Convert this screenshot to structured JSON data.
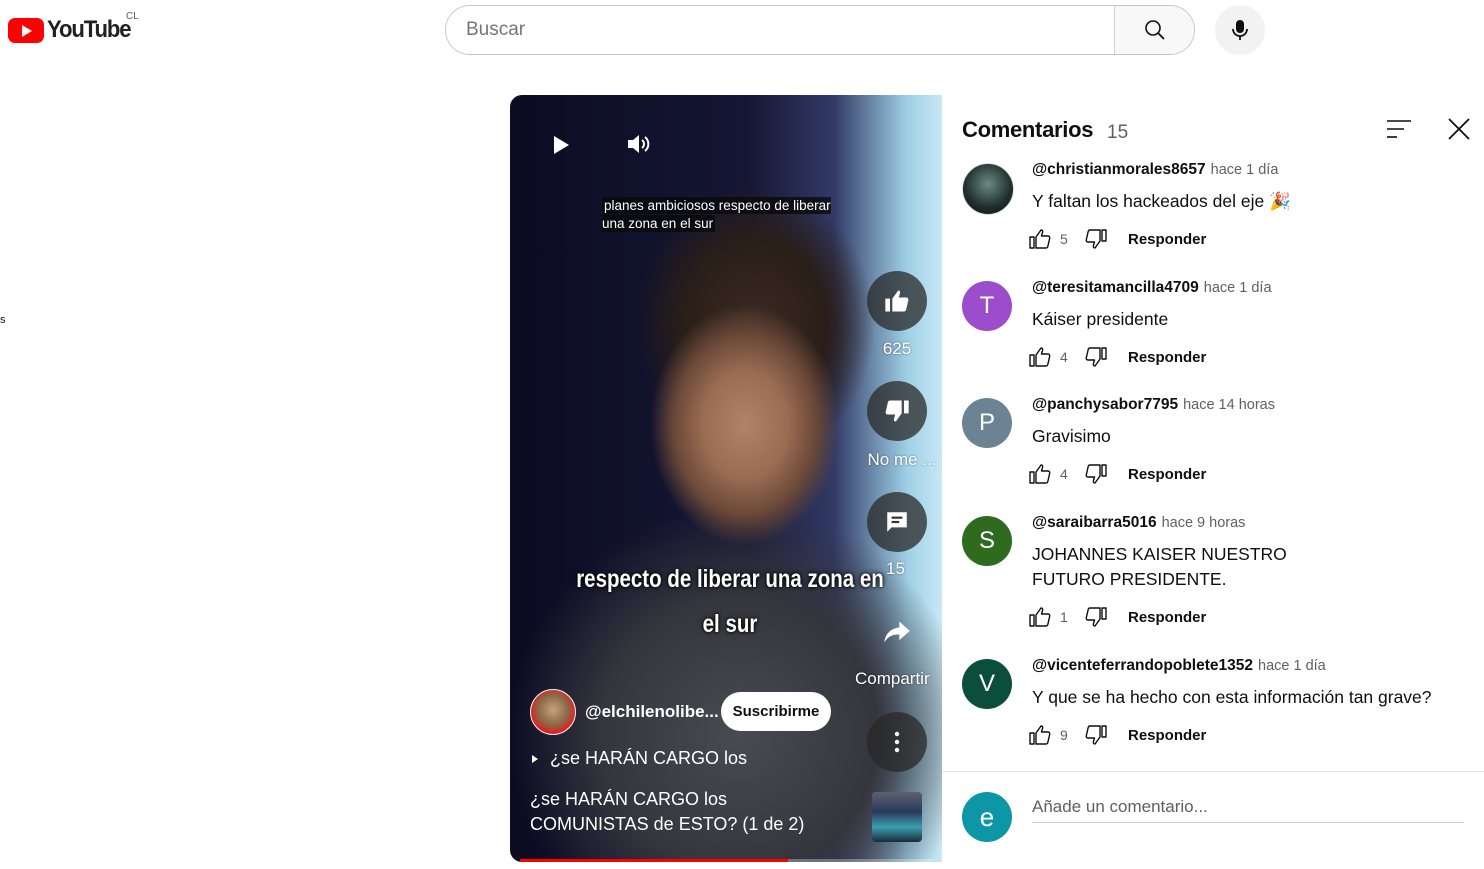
{
  "header": {
    "logo_text": "YouTube",
    "region": "CL",
    "search_placeholder": "Buscar",
    "edge_fragment": "s"
  },
  "video": {
    "caption_top": "planes ambiciosos respecto de liberar una zona en el sur",
    "caption_big_line1": "respecto de liberar una zona en",
    "caption_big_line2": "el sur",
    "like_count": "625",
    "dislike_label": "No me ...",
    "comments_count": "15",
    "share_label": "Compartir",
    "channel_name": "@elchilenolibe...",
    "subscribe_label": "Suscribirme",
    "playlist_label": "¿se HARÁN CARGO los",
    "title": "¿se HARÁN CARGO los COMUNISTAS de ESTO? (1 de 2)",
    "progress_fraction": 0.65
  },
  "comments_panel": {
    "title": "Comentarios",
    "count": "15",
    "add_placeholder": "Añade un comentario...",
    "current_user_initial": "e",
    "reply_label": "Responder",
    "comments": [
      {
        "author": "@christianmorales8657",
        "time": "hace 1 día",
        "text": "Y faltan los hackeados del eje 🎉",
        "likes": "5",
        "initial": "",
        "color": "#2a3a3a"
      },
      {
        "author": "@teresitamancilla4709",
        "time": "hace 1 día",
        "text": "Káiser presidente",
        "likes": "4",
        "initial": "T",
        "color": "#9c4dcc"
      },
      {
        "author": "@panchysabor7795",
        "time": "hace 14 horas",
        "text": "Gravisimo",
        "likes": "4",
        "initial": "P",
        "color": "#6b8393"
      },
      {
        "author": "@saraibarra5016",
        "time": "hace 9 horas",
        "text": "JOHANNES KAISER NUESTRO FUTURO PRESIDENTE.",
        "likes": "1",
        "initial": "S",
        "color": "#2e6b1f"
      },
      {
        "author": "@vicenteferrandopoblete1352",
        "time": "hace 1 día",
        "text": "Y que se ha hecho con esta información tan grave?",
        "likes": "9",
        "initial": "V",
        "color": "#0b4f3b"
      }
    ]
  }
}
